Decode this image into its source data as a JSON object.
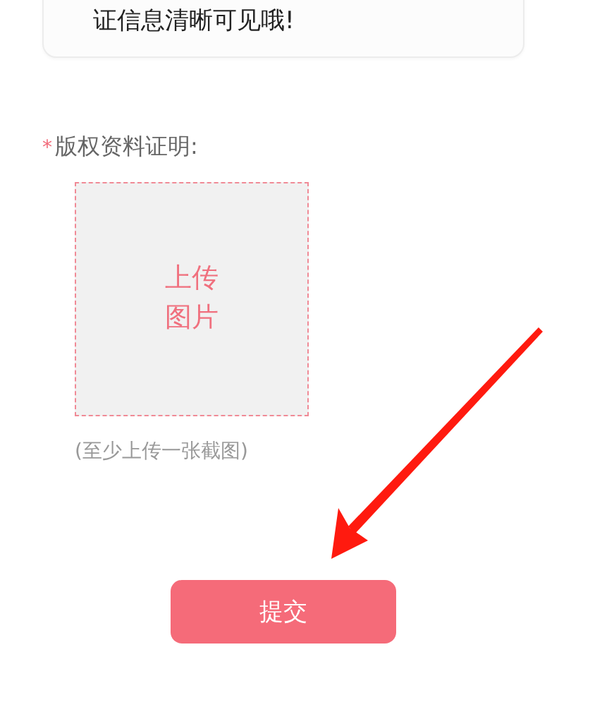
{
  "notice_card": {
    "text": "证信息清晰可见哦!"
  },
  "field": {
    "required_mark": "*",
    "label": "版权资料证明:"
  },
  "upload": {
    "line_1": "上传",
    "line_2": "图片"
  },
  "upload_hint": "(至少上传一张截图)",
  "submit_button": "提交"
}
